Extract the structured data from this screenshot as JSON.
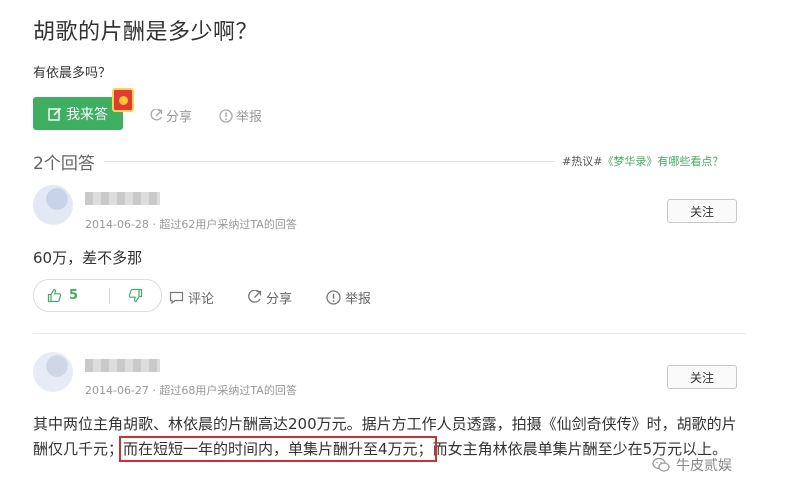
{
  "question": {
    "title": "胡歌的片酬是多少啊？",
    "description": "有依晨多吗？"
  },
  "actions": {
    "answer_label": "我来答",
    "share_label": "分享",
    "report_label": "举报"
  },
  "answers_header": {
    "count_label": "2个回答",
    "hot_tag": "#热议#",
    "hot_topic": "《梦华录》有哪些看点？"
  },
  "answers": [
    {
      "date": "2014-06-28",
      "meta": "· 超过62用户采纳过TA的回答",
      "follow_label": "关注",
      "text": "60万，差不多那",
      "upvotes": "5",
      "comment_label": "评论",
      "share_label": "分享",
      "report_label": "举报"
    },
    {
      "date": "2014-06-27",
      "meta": "· 超过68用户采纳过TA的回答",
      "follow_label": "关注",
      "text_before": "其中两位主角胡歌、林依晨的片酬高达200万元。据片方工作人员透露，拍摄《仙剑奇侠传》时，胡歌的片酬仅几千元；",
      "text_highlight": "而在短短一年的时间内，单集片酬升至4万元；",
      "text_after": "而女主角林依晨单集片酬至少在5万元以上。"
    }
  ],
  "watermark": "牛皮贰娱",
  "colors": {
    "accent_green": "#3eaf60",
    "highlight_red": "#d32f2f"
  }
}
